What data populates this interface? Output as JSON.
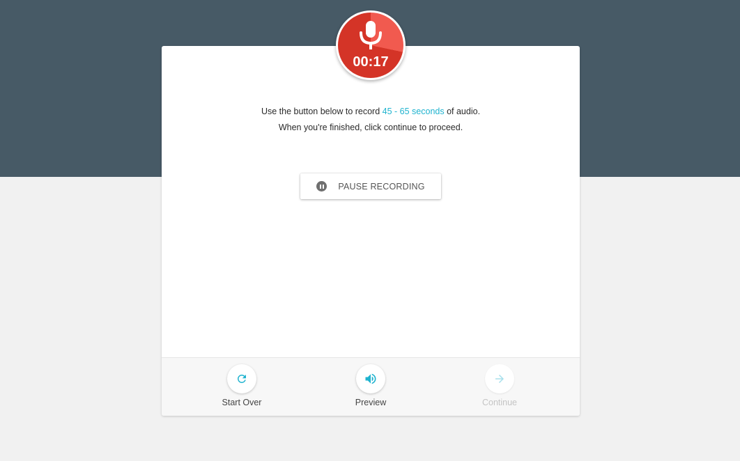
{
  "recorder": {
    "timer": "00:17"
  },
  "instructions": {
    "line1_before": "Use the button below to record ",
    "line1_highlight": "45 - 65 seconds",
    "line1_after": " of audio.",
    "line2": "When you're finished, click continue to proceed."
  },
  "pause_button": {
    "label": "PAUSE RECORDING",
    "icon": "pause-icon"
  },
  "footer": {
    "actions": [
      {
        "label": "Start Over",
        "icon": "refresh-icon",
        "enabled": true
      },
      {
        "label": "Preview",
        "icon": "speaker-icon",
        "enabled": true
      },
      {
        "label": "Continue",
        "icon": "arrow-right-icon",
        "enabled": false
      }
    ]
  },
  "colors": {
    "header_band": "#475a66",
    "background": "#f1f1f1",
    "accent": "#1fb3cf",
    "record_red": "#d43427",
    "record_red_light": "#f15a4f"
  }
}
